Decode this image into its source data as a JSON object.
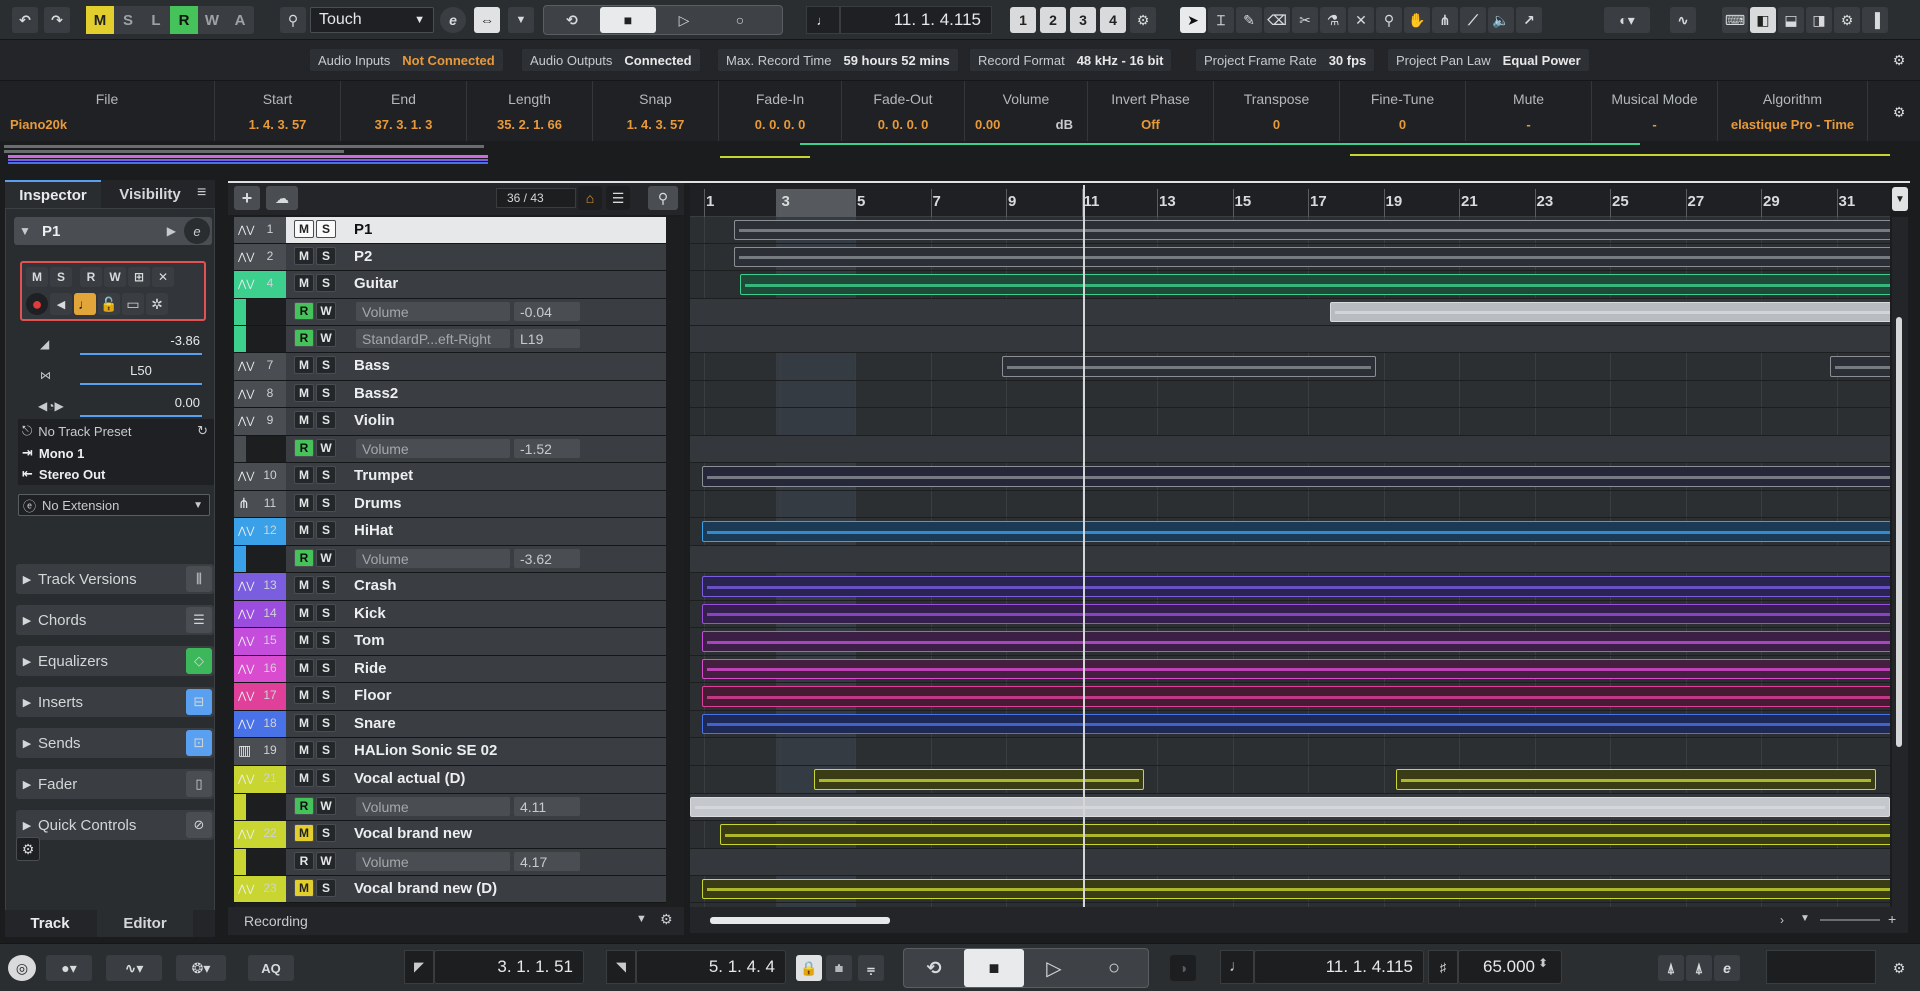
{
  "toolbar": {
    "modes": [
      "M",
      "S",
      "L",
      "R",
      "W",
      "A"
    ],
    "automation_mode": "Touch",
    "e_button": "e",
    "position": "11. 1. 4.115",
    "quantize_nums": [
      "1",
      "2",
      "3",
      "4"
    ]
  },
  "statusline": {
    "audio_inputs_label": "Audio Inputs",
    "audio_inputs_value": "Not Connected",
    "audio_outputs_label": "Audio Outputs",
    "audio_outputs_value": "Connected",
    "max_record_label": "Max. Record Time",
    "max_record_value": "59 hours 52 mins",
    "record_format_label": "Record Format",
    "record_format_value": "48 kHz - 16 bit",
    "frame_rate_label": "Project Frame Rate",
    "frame_rate_value": "30 fps",
    "pan_law_label": "Project Pan Law",
    "pan_law_value": "Equal Power"
  },
  "infoline": [
    {
      "h": "File",
      "v": "Piano20k"
    },
    {
      "h": "Start",
      "v": "1. 4. 3. 57"
    },
    {
      "h": "End",
      "v": "37. 3. 1.   3"
    },
    {
      "h": "Length",
      "v": "35. 2. 1. 66"
    },
    {
      "h": "Snap",
      "v": "1. 4. 3. 57"
    },
    {
      "h": "Fade-In",
      "v": "0. 0. 0.   0"
    },
    {
      "h": "Fade-Out",
      "v": "0. 0. 0.   0"
    },
    {
      "h": "Volume",
      "v": "0.00",
      "unit": "dB"
    },
    {
      "h": "Invert Phase",
      "v": "Off"
    },
    {
      "h": "Transpose",
      "v": "0"
    },
    {
      "h": "Fine-Tune",
      "v": "0"
    },
    {
      "h": "Mute",
      "v": "-"
    },
    {
      "h": "Musical Mode",
      "v": "-"
    },
    {
      "h": "Algorithm",
      "v": "elastique Pro - Time"
    }
  ],
  "inspector": {
    "tab_inspector": "Inspector",
    "tab_visibility": "Visibility",
    "track_name": "P1",
    "volume": "-3.86",
    "pan": "L50",
    "delay": "0.00",
    "preset": "No Track Preset",
    "input": "Mono 1",
    "output": "Stereo Out",
    "extension": "No Extension",
    "sections": [
      "Track Versions",
      "Chords",
      "Equalizers",
      "Inserts",
      "Sends",
      "Fader",
      "Quick Controls"
    ],
    "bottom_tab_track": "Track",
    "bottom_tab_editor": "Editor"
  },
  "tracklist": {
    "count": "36 / 43",
    "footer": "Recording",
    "tracks": [
      {
        "num": "1",
        "name": "P1",
        "color": "#ffffff",
        "type": "audio"
      },
      {
        "num": "2",
        "name": "P2",
        "color": "#ffffff",
        "type": "audio"
      },
      {
        "num": "4",
        "name": "Guitar",
        "color": "#3ccf8e",
        "type": "audio"
      },
      {
        "num": "",
        "name": "Volume",
        "value": "-0.04",
        "color": "#3ccf8e",
        "type": "auto"
      },
      {
        "num": "",
        "name": "StandardP...eft-Right",
        "value": "L19",
        "color": "#3ccf8e",
        "type": "auto"
      },
      {
        "num": "7",
        "name": "Bass",
        "color": "#ffffff",
        "type": "audio"
      },
      {
        "num": "8",
        "name": "Bass2",
        "color": "#ffffff",
        "type": "audio"
      },
      {
        "num": "9",
        "name": "Violin",
        "color": "#ffffff",
        "type": "audio"
      },
      {
        "num": "",
        "name": "Volume",
        "value": "-1.52",
        "color": "#ffffff",
        "type": "auto"
      },
      {
        "num": "10",
        "name": "Trumpet",
        "color": "#ffffff",
        "type": "audio"
      },
      {
        "num": "11",
        "name": "Drums",
        "color": "#ffffff",
        "type": "folder"
      },
      {
        "num": "12",
        "name": "HiHat",
        "color": "#3aa0e8",
        "type": "audio"
      },
      {
        "num": "",
        "name": "Volume",
        "value": "-3.62",
        "color": "#3aa0e8",
        "type": "auto"
      },
      {
        "num": "13",
        "name": "Crash",
        "color": "#7b5de0",
        "type": "audio"
      },
      {
        "num": "14",
        "name": "Kick",
        "color": "#9b4de0",
        "type": "audio"
      },
      {
        "num": "15",
        "name": "Tom",
        "color": "#c44ddc",
        "type": "audio"
      },
      {
        "num": "16",
        "name": "Ride",
        "color": "#d94ccf",
        "type": "audio"
      },
      {
        "num": "17",
        "name": "Floor",
        "color": "#e0409a",
        "type": "audio"
      },
      {
        "num": "18",
        "name": "Snare",
        "color": "#4a72e8",
        "type": "audio"
      },
      {
        "num": "19",
        "name": "HALion Sonic SE 02",
        "color": "#ffffff",
        "type": "inst"
      },
      {
        "num": "21",
        "name": "Vocal actual (D)",
        "color": "#c9d632",
        "type": "audio"
      },
      {
        "num": "",
        "name": "Volume",
        "value": "4.11",
        "color": "#c9d632",
        "type": "auto"
      },
      {
        "num": "22",
        "name": "Vocal brand new",
        "color": "#c9d632",
        "type": "audio",
        "m_active": true
      },
      {
        "num": "",
        "name": "Volume",
        "value": "4.17",
        "color": "#c9d632",
        "type": "auto",
        "r_off": true
      },
      {
        "num": "23",
        "name": "Vocal brand new (D)",
        "color": "#c9d632",
        "type": "audio",
        "m_active": true
      }
    ]
  },
  "ruler": [
    "1",
    "3",
    "5",
    "7",
    "9",
    "11",
    "13",
    "15",
    "17",
    "19",
    "21",
    "23",
    "25",
    "27",
    "29",
    "31"
  ],
  "transport": {
    "aq": "AQ",
    "left_locator": "3. 1. 1. 51",
    "right_locator": "5. 1. 4.   4",
    "position": "11. 1. 4.115",
    "tempo": "65.000"
  }
}
